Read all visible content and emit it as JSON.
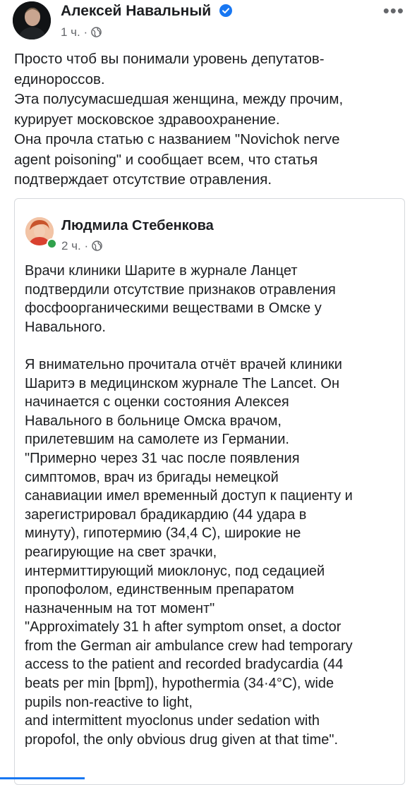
{
  "post": {
    "author": "Алексей Навальный",
    "time": "1 ч.",
    "separator": "·",
    "more_icon": "more-horizontal-icon",
    "text_lines": [
      "Просто чтоб вы понимали уровень депутатов-",
      "единороссов.",
      "Эта полусумасшедшая женщина, между прочим,",
      "курирует московское здравоохранение.",
      "Она прочла статью с названием \"Novichok nerve",
      "agent poisoning\" и сообщает всем, что статья",
      "подтверждает отсутствие отравления."
    ]
  },
  "shared": {
    "author": "Людмила Стебенкова",
    "time": "2 ч.",
    "separator": "·",
    "text_lines": [
      "Врачи клиники Шарите в журнале Ланцет",
      "подтвердили отсутствие признаков отравления",
      "фосфоорганическими веществами в Омске у",
      "Навального.",
      "",
      "Я внимательно прочитала отчёт врачей клиники",
      "Шаритэ в медицинском журнале The Lancet. Он",
      "начинается с оценки состояния Алексея",
      "Навального в больнице Омска врачом,",
      "прилетевшим на самолете из Германии.",
      "\"Примерно через 31 час после появления",
      "симптомов, врач из бригады немецкой",
      "санавиации имел временный доступ к пациенту и",
      "зарегистрировал брадикардию (44 удара в",
      "минуту), гипотермию (34,4 С),  широкие не",
      "реагирующие на  свет зрачки,",
      "интермиттирующий миоклонус, под седацией",
      "пропофолом, единственным препаратом",
      "назначенным на тот момент\"",
      "\"Approximately 31 h after symptom onset, a doctor",
      "from the German air ambulance crew had temporary",
      "access to the patient and recorded bradycardia (44",
      "beats per min [bpm]), hypothermia (34·4°C), wide",
      "pupils non-reactive to light,",
      "and intermittent myoclonus under sedation with",
      "propofol, the only obvious drug given at that time\"."
    ]
  },
  "colors": {
    "text": "#1c1e21",
    "meta": "#65676b",
    "verified": "#1877f2",
    "online": "#31a24c",
    "border": "#d6d9dd"
  }
}
